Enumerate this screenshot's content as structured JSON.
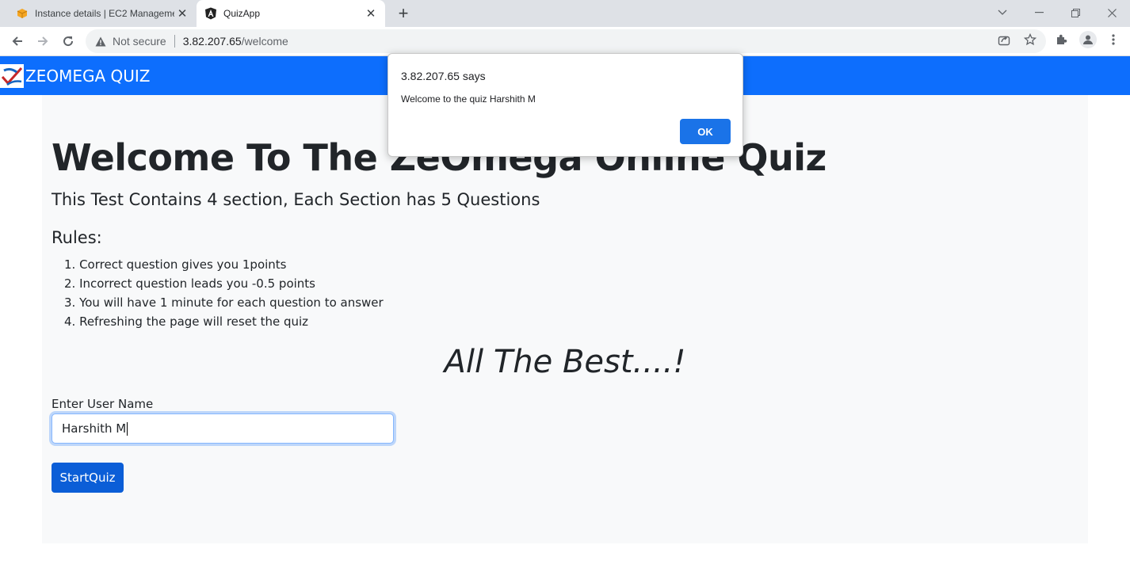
{
  "browser": {
    "tabs": [
      {
        "title": "Instance details | EC2 Manageme",
        "favicon": "aws-box-icon",
        "active": false
      },
      {
        "title": "QuizApp",
        "favicon": "angular-icon",
        "active": true
      }
    ],
    "new_tab_label": "+",
    "address": {
      "security_label": "Not secure",
      "host": "3.82.207.65",
      "path": "/welcome"
    }
  },
  "page": {
    "navbar": {
      "brand": "ZEOMEGA QUIZ",
      "color": "#0d6efd"
    },
    "heading": "Welcome To The ZeOmega Online Quiz",
    "lead": "This Test Contains 4 section, Each Section has 5 Questions",
    "rules_title": "Rules:",
    "rules": [
      "1. Correct question gives you 1points",
      "2. Incorrect question leads you -0.5 points",
      "3. You will have 1 minute for each question to answer",
      "4. Refreshing the page will reset the quiz"
    ],
    "best_wishes": "All The Best....!",
    "username_label": "Enter User Name",
    "username_value": "Harshith M",
    "start_button": "StartQuiz"
  },
  "dialog": {
    "title": "3.82.207.65 says",
    "message": "Welcome to the quiz Harshith M",
    "ok_label": "OK"
  }
}
